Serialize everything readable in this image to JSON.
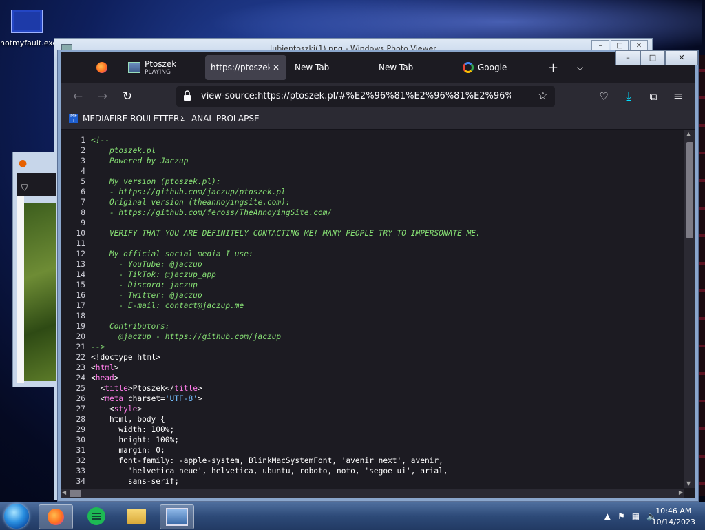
{
  "desktop": {
    "icon_label": "notmyfault.exe"
  },
  "photo_viewer": {
    "title": "lubieptoszki(1).png - Windows Photo Viewer"
  },
  "browser": {
    "tabs": [
      {
        "label": "Ptoszek",
        "sublabel": "PLAYING",
        "icon": "image-icon"
      },
      {
        "label": "https://ptoszek.pl/",
        "active": true
      },
      {
        "label": "New Tab"
      },
      {
        "label": "New Tab"
      },
      {
        "label": "Google",
        "icon": "google-icon"
      }
    ],
    "url": "view-source:https://ptoszek.pl/#%E2%96%81%E2%96%81%E2%96%83%E2%96",
    "bookmarks": [
      {
        "label": "MEDIAFIRE ROULETTER",
        "icon_text": "MF T"
      },
      {
        "label": "ANAL PROLAPSE",
        "icon_text": "Σ"
      }
    ]
  },
  "source_lines": [
    {
      "n": "1",
      "parts": [
        {
          "c": "cm",
          "t": "<!--"
        }
      ]
    },
    {
      "n": "2",
      "parts": [
        {
          "c": "cm",
          "t": "    ptoszek.pl"
        }
      ]
    },
    {
      "n": "3",
      "parts": [
        {
          "c": "cm",
          "t": "    Powered by Jaczup"
        }
      ]
    },
    {
      "n": "4",
      "parts": []
    },
    {
      "n": "5",
      "parts": [
        {
          "c": "cm",
          "t": "    My version (ptoszek.pl):"
        }
      ]
    },
    {
      "n": "6",
      "parts": [
        {
          "c": "cm",
          "t": "    - https://github.com/jaczup/ptoszek.pl"
        }
      ]
    },
    {
      "n": "7",
      "parts": [
        {
          "c": "cm",
          "t": "    Original version (theannoyingsite.com):"
        }
      ]
    },
    {
      "n": "8",
      "parts": [
        {
          "c": "cm",
          "t": "    - https://github.com/feross/TheAnnoyingSite.com/"
        }
      ]
    },
    {
      "n": "9",
      "parts": []
    },
    {
      "n": "10",
      "parts": [
        {
          "c": "cm",
          "t": "    VERIFY THAT YOU ARE DEFINITELY CONTACTING ME! MANY PEOPLE TRY TO IMPERSONATE ME."
        }
      ]
    },
    {
      "n": "11",
      "parts": []
    },
    {
      "n": "12",
      "parts": [
        {
          "c": "cm",
          "t": "    My official social media I use:"
        }
      ]
    },
    {
      "n": "13",
      "parts": [
        {
          "c": "cm",
          "t": "      - YouTube: @jaczup"
        }
      ]
    },
    {
      "n": "14",
      "parts": [
        {
          "c": "cm",
          "t": "      - TikTok: @jaczup_app"
        }
      ]
    },
    {
      "n": "15",
      "parts": [
        {
          "c": "cm",
          "t": "      - Discord: jaczup"
        }
      ]
    },
    {
      "n": "16",
      "parts": [
        {
          "c": "cm",
          "t": "      - Twitter: @jaczup"
        }
      ]
    },
    {
      "n": "17",
      "parts": [
        {
          "c": "cm",
          "t": "      - E-mail: contact@jaczup.me"
        }
      ]
    },
    {
      "n": "18",
      "parts": []
    },
    {
      "n": "19",
      "parts": [
        {
          "c": "cm",
          "t": "    Contributors:"
        }
      ]
    },
    {
      "n": "20",
      "parts": [
        {
          "c": "cm",
          "t": "      @jaczup - https://github.com/jaczup"
        }
      ]
    },
    {
      "n": "21",
      "parts": [
        {
          "c": "cm",
          "t": "-->"
        }
      ]
    },
    {
      "n": "22",
      "parts": [
        {
          "c": "tx",
          "t": "<!doctype html>"
        }
      ]
    },
    {
      "n": "23",
      "parts": [
        {
          "c": "tx",
          "t": "<"
        },
        {
          "c": "tg",
          "t": "html"
        },
        {
          "c": "tx",
          "t": ">"
        }
      ]
    },
    {
      "n": "24",
      "parts": [
        {
          "c": "tx",
          "t": "<"
        },
        {
          "c": "tg",
          "t": "head"
        },
        {
          "c": "tx",
          "t": ">"
        }
      ]
    },
    {
      "n": "25",
      "parts": [
        {
          "c": "tx",
          "t": "  <"
        },
        {
          "c": "tg",
          "t": "title"
        },
        {
          "c": "tx",
          "t": ">Ptoszek</"
        },
        {
          "c": "tg",
          "t": "title"
        },
        {
          "c": "tx",
          "t": ">"
        }
      ]
    },
    {
      "n": "26",
      "parts": [
        {
          "c": "tx",
          "t": "  <"
        },
        {
          "c": "tg",
          "t": "meta"
        },
        {
          "c": "tx",
          "t": " charset="
        },
        {
          "c": "st",
          "t": "'UTF-8'"
        },
        {
          "c": "tx",
          "t": ">"
        }
      ]
    },
    {
      "n": "27",
      "parts": [
        {
          "c": "tx",
          "t": "    <"
        },
        {
          "c": "tg",
          "t": "style"
        },
        {
          "c": "tx",
          "t": ">"
        }
      ]
    },
    {
      "n": "28",
      "parts": [
        {
          "c": "tx",
          "t": "    html, body {"
        }
      ]
    },
    {
      "n": "29",
      "parts": [
        {
          "c": "tx",
          "t": "      width: 100%;"
        }
      ]
    },
    {
      "n": "30",
      "parts": [
        {
          "c": "tx",
          "t": "      height: 100%;"
        }
      ]
    },
    {
      "n": "31",
      "parts": [
        {
          "c": "tx",
          "t": "      margin: 0;"
        }
      ]
    },
    {
      "n": "32",
      "parts": [
        {
          "c": "tx",
          "t": "      font-family: -apple-system, BlinkMacSystemFont, 'avenir next', avenir,"
        }
      ]
    },
    {
      "n": "33",
      "parts": [
        {
          "c": "tx",
          "t": "        'helvetica neue', helvetica, ubuntu, roboto, noto, 'segoe ui', arial,"
        }
      ]
    },
    {
      "n": "34",
      "parts": [
        {
          "c": "tx",
          "t": "        sans-serif;"
        }
      ]
    }
  ],
  "taskbar": {
    "time": "10:46 AM",
    "date": "10/14/2023"
  }
}
